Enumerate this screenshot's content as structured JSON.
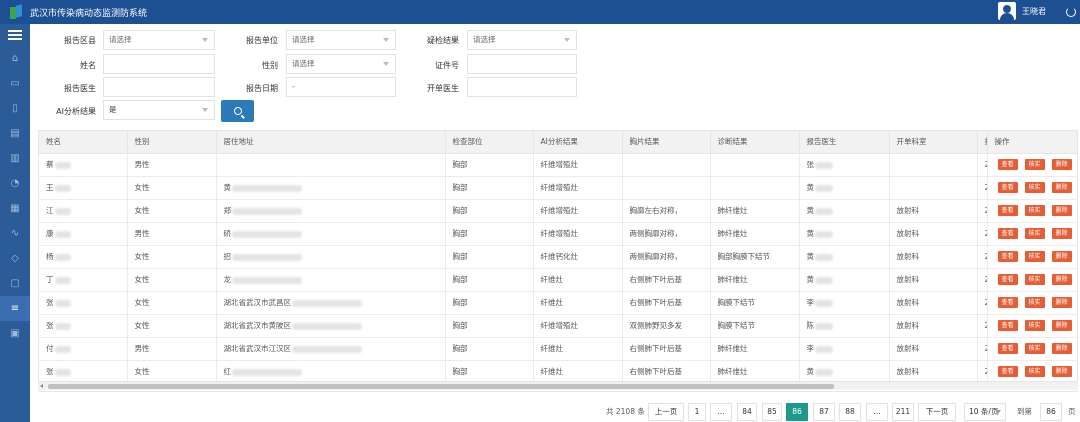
{
  "header": {
    "title": "武汉市传染病动态监测防系统",
    "user_name": "王晓君"
  },
  "sidebar": {
    "icons": [
      "menu-icon",
      "home-icon",
      "monitor-icon",
      "file-icon",
      "document-icon",
      "bar-chart-icon",
      "pie-chart-icon",
      "calendar-icon",
      "line-chart-icon",
      "map-icon",
      "book-icon",
      "list-icon",
      "settings-icon"
    ]
  },
  "filters": {
    "report_district": {
      "label": "报告区县",
      "placeholder": "请选择"
    },
    "report_unit": {
      "label": "报告单位",
      "placeholder": "请选择"
    },
    "exam_result": {
      "label": "疑检结果",
      "placeholder": "请选择"
    },
    "name": {
      "label": "姓名",
      "value": ""
    },
    "gender": {
      "label": "性别",
      "placeholder": "请选择"
    },
    "id_number": {
      "label": "证件号",
      "value": ""
    },
    "report_doctor": {
      "label": "报告医生",
      "value": ""
    },
    "report_date": {
      "label": "报告日期",
      "value": "-"
    },
    "order_doctor": {
      "label": "开单医生",
      "value": ""
    },
    "ai_result": {
      "label": "AI分析结果",
      "value": "是"
    }
  },
  "table": {
    "columns": [
      "姓名",
      "性别",
      "居住地址",
      "检查部位",
      "AI分析结果",
      "胸片结果",
      "诊断结果",
      "报告医生",
      "开单科室",
      "报",
      "操作"
    ],
    "action_labels": [
      "查看",
      "核实",
      "删除"
    ],
    "rows": [
      {
        "name": "蔡",
        "gender": "男性",
        "address": "",
        "part": "胸部",
        "ai": "纤维增殖灶",
        "xray": "",
        "diagnosis": "",
        "doctor": "张",
        "dept": "",
        "rep": "2"
      },
      {
        "name": "王",
        "gender": "女性",
        "address": "黄",
        "part": "胸部",
        "ai": "纤维增殖灶",
        "xray": "",
        "diagnosis": "",
        "doctor": "黄",
        "dept": "",
        "rep": "2"
      },
      {
        "name": "江",
        "gender": "女性",
        "address": "郑",
        "part": "胸部",
        "ai": "纤维增殖灶",
        "xray": "胸廓左右对称，",
        "diagnosis": "肺纤维灶",
        "doctor": "黄",
        "dept": "放射科",
        "rep": "2"
      },
      {
        "name": "康",
        "gender": "男性",
        "address": "硚",
        "part": "胸部",
        "ai": "纤维增殖灶",
        "xray": "两侧胸廓对称，",
        "diagnosis": "肺纤维灶",
        "doctor": "黄",
        "dept": "放射科",
        "rep": "2"
      },
      {
        "name": "杨",
        "gender": "女性",
        "address": "招",
        "part": "胸部",
        "ai": "纤维钙化灶",
        "xray": "两侧胸廓对称，",
        "diagnosis": "胸部胸膜下结节",
        "doctor": "黄",
        "dept": "放射科",
        "rep": "2"
      },
      {
        "name": "丁",
        "gender": "女性",
        "address": "龙",
        "part": "胸部",
        "ai": "纤维灶",
        "xray": "右侧肺下叶后基",
        "diagnosis": "肺纤维灶",
        "doctor": "黄",
        "dept": "放射科",
        "rep": "2"
      },
      {
        "name": "张",
        "gender": "女性",
        "address": "湖北省武汉市武昌区",
        "part": "胸部",
        "ai": "纤维灶",
        "xray": "右侧肺下叶后基",
        "diagnosis": "胸膜下结节",
        "doctor": "李",
        "dept": "放射科",
        "rep": "2"
      },
      {
        "name": "张",
        "gender": "女性",
        "address": "湖北省武汉市黄陂区",
        "part": "胸部",
        "ai": "纤维增殖灶",
        "xray": "双侧肺野见多发",
        "diagnosis": "胸膜下结节",
        "doctor": "陈",
        "dept": "放射科",
        "rep": "2"
      },
      {
        "name": "付",
        "gender": "男性",
        "address": "湖北省武汉市江汉区",
        "part": "胸部",
        "ai": "纤维灶",
        "xray": "右侧肺下叶后基",
        "diagnosis": "肺纤维灶",
        "doctor": "李",
        "dept": "放射科",
        "rep": "2"
      },
      {
        "name": "张",
        "gender": "女性",
        "address": "红",
        "part": "胸部",
        "ai": "纤维灶",
        "xray": "右侧肺下叶后基",
        "diagnosis": "肺纤维灶",
        "doctor": "黄",
        "dept": "放射科",
        "rep": "2"
      }
    ]
  },
  "pagination": {
    "total": "共 2108 条",
    "prev": "上一页",
    "pages": [
      "1",
      "...",
      "84",
      "85",
      "86",
      "87",
      "88",
      "...",
      "211"
    ],
    "current": "86",
    "next": "下一页",
    "page_size": "10 条/页",
    "goto_label": "到第",
    "goto_value": "86",
    "page_suffix": "页"
  }
}
